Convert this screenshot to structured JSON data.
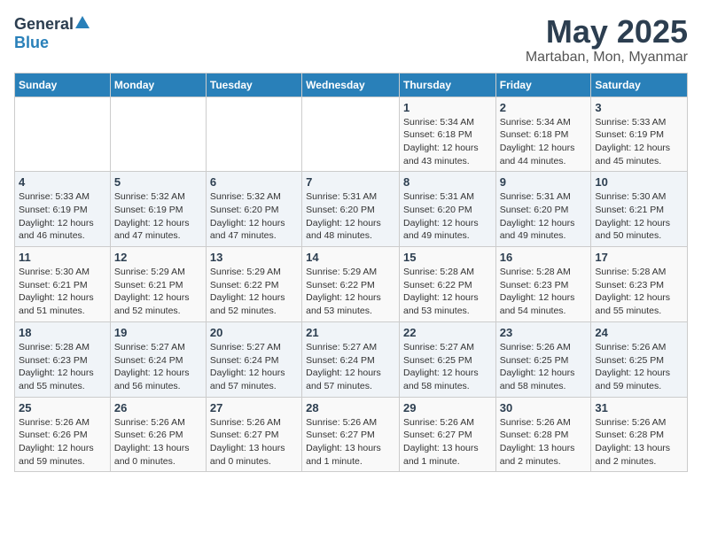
{
  "logo": {
    "general": "General",
    "blue": "Blue"
  },
  "title": "May 2025",
  "subtitle": "Martaban, Mon, Myanmar",
  "headers": [
    "Sunday",
    "Monday",
    "Tuesday",
    "Wednesday",
    "Thursday",
    "Friday",
    "Saturday"
  ],
  "weeks": [
    [
      {
        "day": "",
        "info": ""
      },
      {
        "day": "",
        "info": ""
      },
      {
        "day": "",
        "info": ""
      },
      {
        "day": "",
        "info": ""
      },
      {
        "day": "1",
        "info": "Sunrise: 5:34 AM\nSunset: 6:18 PM\nDaylight: 12 hours\nand 43 minutes."
      },
      {
        "day": "2",
        "info": "Sunrise: 5:34 AM\nSunset: 6:18 PM\nDaylight: 12 hours\nand 44 minutes."
      },
      {
        "day": "3",
        "info": "Sunrise: 5:33 AM\nSunset: 6:19 PM\nDaylight: 12 hours\nand 45 minutes."
      }
    ],
    [
      {
        "day": "4",
        "info": "Sunrise: 5:33 AM\nSunset: 6:19 PM\nDaylight: 12 hours\nand 46 minutes."
      },
      {
        "day": "5",
        "info": "Sunrise: 5:32 AM\nSunset: 6:19 PM\nDaylight: 12 hours\nand 47 minutes."
      },
      {
        "day": "6",
        "info": "Sunrise: 5:32 AM\nSunset: 6:20 PM\nDaylight: 12 hours\nand 47 minutes."
      },
      {
        "day": "7",
        "info": "Sunrise: 5:31 AM\nSunset: 6:20 PM\nDaylight: 12 hours\nand 48 minutes."
      },
      {
        "day": "8",
        "info": "Sunrise: 5:31 AM\nSunset: 6:20 PM\nDaylight: 12 hours\nand 49 minutes."
      },
      {
        "day": "9",
        "info": "Sunrise: 5:31 AM\nSunset: 6:20 PM\nDaylight: 12 hours\nand 49 minutes."
      },
      {
        "day": "10",
        "info": "Sunrise: 5:30 AM\nSunset: 6:21 PM\nDaylight: 12 hours\nand 50 minutes."
      }
    ],
    [
      {
        "day": "11",
        "info": "Sunrise: 5:30 AM\nSunset: 6:21 PM\nDaylight: 12 hours\nand 51 minutes."
      },
      {
        "day": "12",
        "info": "Sunrise: 5:29 AM\nSunset: 6:21 PM\nDaylight: 12 hours\nand 52 minutes."
      },
      {
        "day": "13",
        "info": "Sunrise: 5:29 AM\nSunset: 6:22 PM\nDaylight: 12 hours\nand 52 minutes."
      },
      {
        "day": "14",
        "info": "Sunrise: 5:29 AM\nSunset: 6:22 PM\nDaylight: 12 hours\nand 53 minutes."
      },
      {
        "day": "15",
        "info": "Sunrise: 5:28 AM\nSunset: 6:22 PM\nDaylight: 12 hours\nand 53 minutes."
      },
      {
        "day": "16",
        "info": "Sunrise: 5:28 AM\nSunset: 6:23 PM\nDaylight: 12 hours\nand 54 minutes."
      },
      {
        "day": "17",
        "info": "Sunrise: 5:28 AM\nSunset: 6:23 PM\nDaylight: 12 hours\nand 55 minutes."
      }
    ],
    [
      {
        "day": "18",
        "info": "Sunrise: 5:28 AM\nSunset: 6:23 PM\nDaylight: 12 hours\nand 55 minutes."
      },
      {
        "day": "19",
        "info": "Sunrise: 5:27 AM\nSunset: 6:24 PM\nDaylight: 12 hours\nand 56 minutes."
      },
      {
        "day": "20",
        "info": "Sunrise: 5:27 AM\nSunset: 6:24 PM\nDaylight: 12 hours\nand 57 minutes."
      },
      {
        "day": "21",
        "info": "Sunrise: 5:27 AM\nSunset: 6:24 PM\nDaylight: 12 hours\nand 57 minutes."
      },
      {
        "day": "22",
        "info": "Sunrise: 5:27 AM\nSunset: 6:25 PM\nDaylight: 12 hours\nand 58 minutes."
      },
      {
        "day": "23",
        "info": "Sunrise: 5:26 AM\nSunset: 6:25 PM\nDaylight: 12 hours\nand 58 minutes."
      },
      {
        "day": "24",
        "info": "Sunrise: 5:26 AM\nSunset: 6:25 PM\nDaylight: 12 hours\nand 59 minutes."
      }
    ],
    [
      {
        "day": "25",
        "info": "Sunrise: 5:26 AM\nSunset: 6:26 PM\nDaylight: 12 hours\nand 59 minutes."
      },
      {
        "day": "26",
        "info": "Sunrise: 5:26 AM\nSunset: 6:26 PM\nDaylight: 13 hours\nand 0 minutes."
      },
      {
        "day": "27",
        "info": "Sunrise: 5:26 AM\nSunset: 6:27 PM\nDaylight: 13 hours\nand 0 minutes."
      },
      {
        "day": "28",
        "info": "Sunrise: 5:26 AM\nSunset: 6:27 PM\nDaylight: 13 hours\nand 1 minute."
      },
      {
        "day": "29",
        "info": "Sunrise: 5:26 AM\nSunset: 6:27 PM\nDaylight: 13 hours\nand 1 minute."
      },
      {
        "day": "30",
        "info": "Sunrise: 5:26 AM\nSunset: 6:28 PM\nDaylight: 13 hours\nand 2 minutes."
      },
      {
        "day": "31",
        "info": "Sunrise: 5:26 AM\nSunset: 6:28 PM\nDaylight: 13 hours\nand 2 minutes."
      }
    ]
  ]
}
